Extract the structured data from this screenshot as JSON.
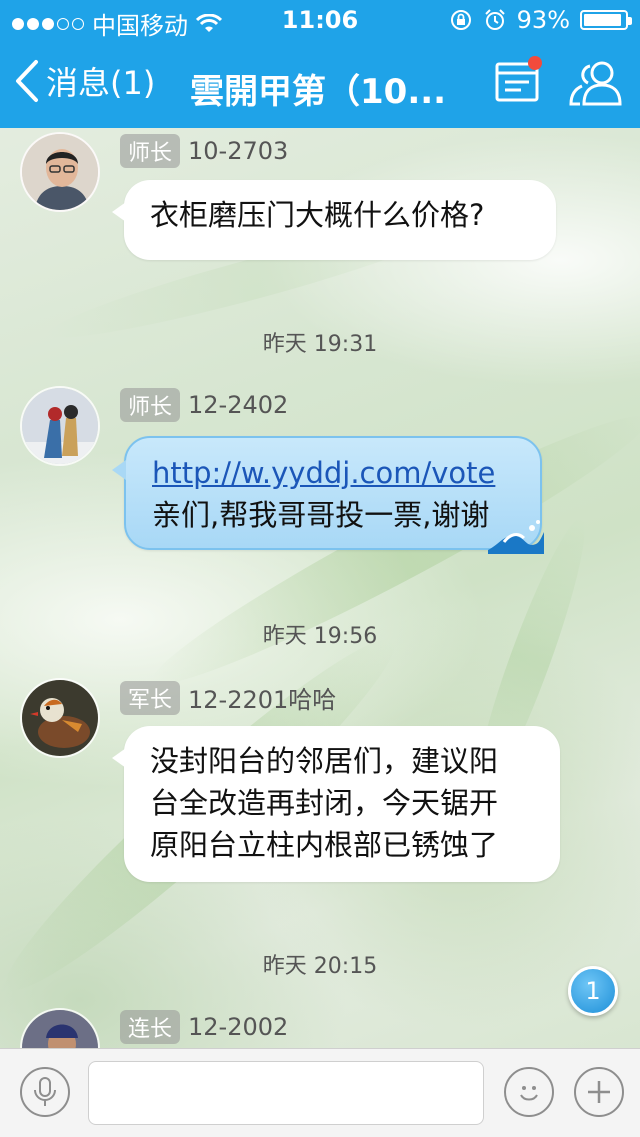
{
  "status_bar": {
    "carrier": "中国移动",
    "time": "11:06",
    "battery_percent": "93%",
    "battery_level": 0.93
  },
  "nav": {
    "back_label": "消息(1)",
    "title": "雲開甲第（10..."
  },
  "messages": [
    {
      "rank": "师长",
      "sender": "10-2703",
      "lines": [
        "衣柜磨压门大概什么价格?"
      ]
    },
    {
      "rank": "师长",
      "sender": "12-2402",
      "link": "http://w.yyddj.com/vote",
      "lines": [
        "亲们,帮我哥哥投一票,谢谢"
      ]
    },
    {
      "rank": "军长",
      "sender": "12-2201哈哈",
      "lines": [
        "没封阳台的邻居们，建议阳",
        "台全改造再封闭，今天锯开",
        "原阳台立柱内根部已锈蚀了"
      ]
    },
    {
      "rank": "连长",
      "sender": "12-2002"
    }
  ],
  "timestamps": [
    "昨天 19:31",
    "昨天 19:56",
    "昨天 20:15"
  ],
  "unread_badge": "1",
  "colors": {
    "accent": "#1fa3e8",
    "badge_red": "#f24b3c"
  }
}
